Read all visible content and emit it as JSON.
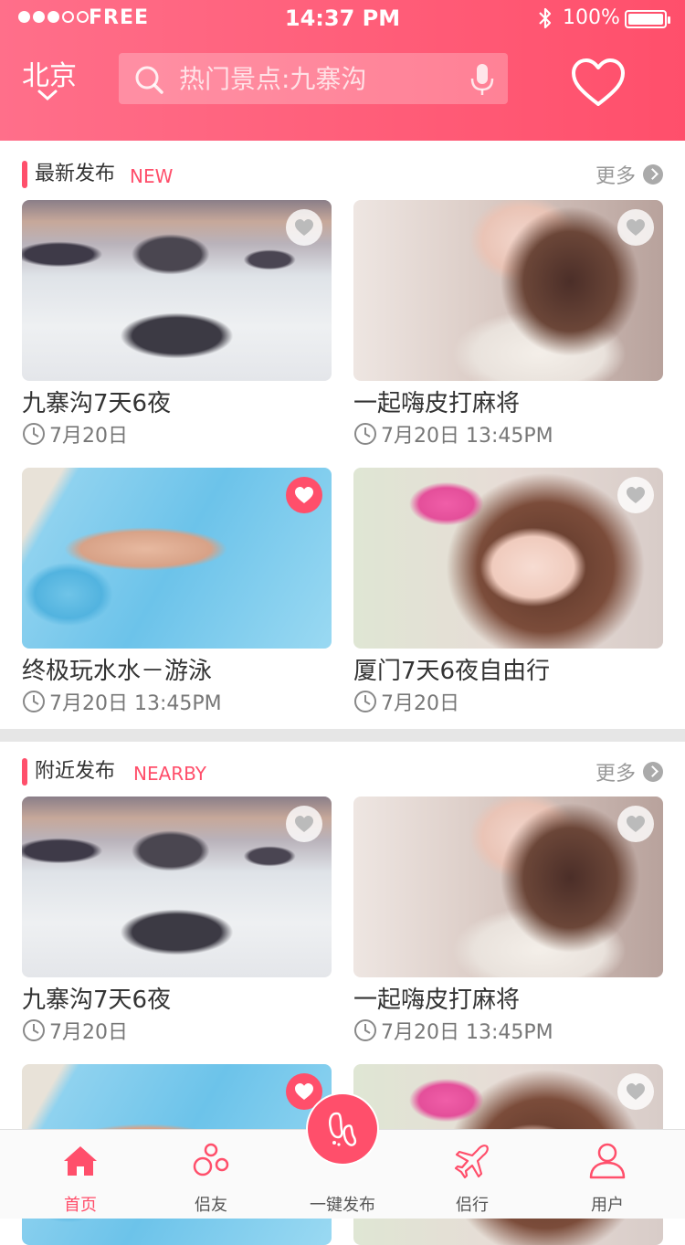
{
  "status_bar": {
    "carrier": "FREE",
    "time": "14:37 PM",
    "battery": "100%"
  },
  "header": {
    "city": "北京",
    "search_placeholder": "热门景点:九寨沟"
  },
  "colors": {
    "accent": "#ff4f6b",
    "header_gradient_start": "#ff6f8a",
    "header_gradient_end": "#ff4f6b"
  },
  "sections": [
    {
      "title": "最新发布",
      "tag": "NEW",
      "more": "更多",
      "items": [
        {
          "title": "九寨沟7天6夜",
          "date": "7月20日",
          "favorited": false,
          "image": "sea-rocks"
        },
        {
          "title": "一起嗨皮打麻将",
          "date": "7月20日 13:45PM",
          "favorited": false,
          "image": "girl-bottle"
        },
        {
          "title": "终极玩水水－游泳",
          "date": "7月20日 13:45PM",
          "favorited": true,
          "image": "pool-legs"
        },
        {
          "title": "厦门7天6夜自由行",
          "date": "7月20日",
          "favorited": false,
          "image": "girl-flower"
        }
      ]
    },
    {
      "title": "附近发布",
      "tag": "NEARBY",
      "more": "更多",
      "items": [
        {
          "title": "九寨沟7天6夜",
          "date": "7月20日",
          "favorited": false,
          "image": "sea-rocks"
        },
        {
          "title": "一起嗨皮打麻将",
          "date": "7月20日 13:45PM",
          "favorited": false,
          "image": "girl-bottle"
        },
        {
          "title": "",
          "date": "",
          "favorited": true,
          "image": "pool-legs"
        },
        {
          "title": "",
          "date": "",
          "favorited": false,
          "image": "girl-flower"
        }
      ]
    }
  ],
  "tabbar": [
    {
      "label": "首页",
      "icon": "home-icon",
      "active": true
    },
    {
      "label": "侣友",
      "icon": "friends-icon",
      "active": false
    },
    {
      "label": "一键发布",
      "icon": "publish-icon",
      "active": false
    },
    {
      "label": "侣行",
      "icon": "plane-icon",
      "active": false
    },
    {
      "label": "用户",
      "icon": "user-icon",
      "active": false
    }
  ]
}
